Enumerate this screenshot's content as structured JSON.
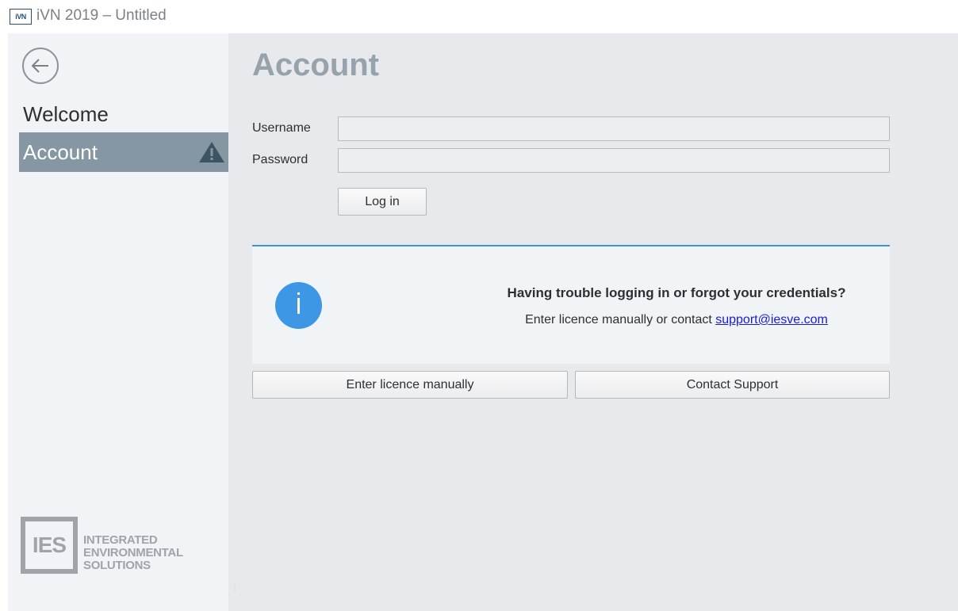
{
  "titlebar": {
    "icon_text": "iVN",
    "title": "iVN 2019 – Untitled"
  },
  "sidebar": {
    "back_icon": "arrow-left-circle-icon",
    "items": [
      {
        "label": "Welcome",
        "selected": false
      },
      {
        "label": "Account",
        "selected": true,
        "badge_icon": "warning-triangle-icon"
      }
    ],
    "logo": {
      "mark": "IES",
      "line1": "INTEGRATED",
      "line2": "ENVIRONMENTAL",
      "line3": "SOLUTIONS"
    }
  },
  "account": {
    "title": "Account",
    "username_label": "Username",
    "username_value": "",
    "password_label": "Password",
    "password_value": "",
    "login_label": "Log in"
  },
  "info": {
    "icon": "info-icon",
    "heading": "Having trouble logging in or forgot your credentials?",
    "text": "Enter licence manually or contact ",
    "link": "support@iesve.com"
  },
  "actions": {
    "enter_licence_label": "Enter licence manually",
    "contact_support_label": "Contact Support"
  },
  "colors": {
    "selected_nav_bg": "#8697a4",
    "title_color": "#96a3ad",
    "info_accent": "#3d97e5",
    "link_color": "#1a1adb",
    "warning_icon": "#3c5564"
  }
}
